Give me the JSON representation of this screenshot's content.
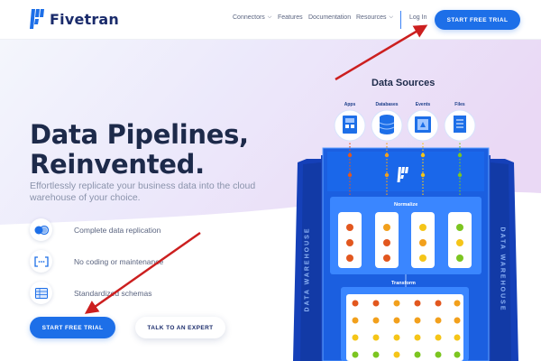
{
  "header": {
    "logo_text": "Fivetran",
    "nav": [
      {
        "label": "Connectors",
        "has_dropdown": true
      },
      {
        "label": "Features",
        "has_dropdown": false
      },
      {
        "label": "Documentation",
        "has_dropdown": false
      },
      {
        "label": "Resources",
        "has_dropdown": true
      }
    ],
    "login_label": "Log In",
    "cta_label": "START FREE TRIAL"
  },
  "hero": {
    "headline_line1": "Data Pipelines,",
    "headline_line2": "Reinvented.",
    "subtitle": "Effortlessly replicate your business data into the cloud warehouse of your choice.",
    "features": [
      {
        "label": "Complete data replication",
        "icon": "toggle-circles-icon"
      },
      {
        "label": "No coding or maintenance",
        "icon": "code-brackets-icon"
      },
      {
        "label": "Standardized schemas",
        "icon": "table-grid-icon"
      }
    ],
    "primary_cta": "START FREE TRIAL",
    "secondary_cta": "TALK TO AN EXPERT"
  },
  "diagram": {
    "title": "Data Sources",
    "sources": [
      {
        "label": "Apps",
        "icon": "apps-icon"
      },
      {
        "label": "Databases",
        "icon": "database-icon"
      },
      {
        "label": "Events",
        "icon": "events-icon"
      },
      {
        "label": "Files",
        "icon": "files-icon"
      }
    ],
    "normalize_label": "Normalize",
    "transform_label": "Transform",
    "warehouse_label": "DATA WAREHOUSE"
  },
  "colors": {
    "brand_blue": "#1d6fe8",
    "navy": "#1d2a4a",
    "dot_red": "#e2571e",
    "dot_orange": "#f2a01c",
    "dot_yellow": "#f5c518",
    "dot_green": "#7cc520"
  }
}
